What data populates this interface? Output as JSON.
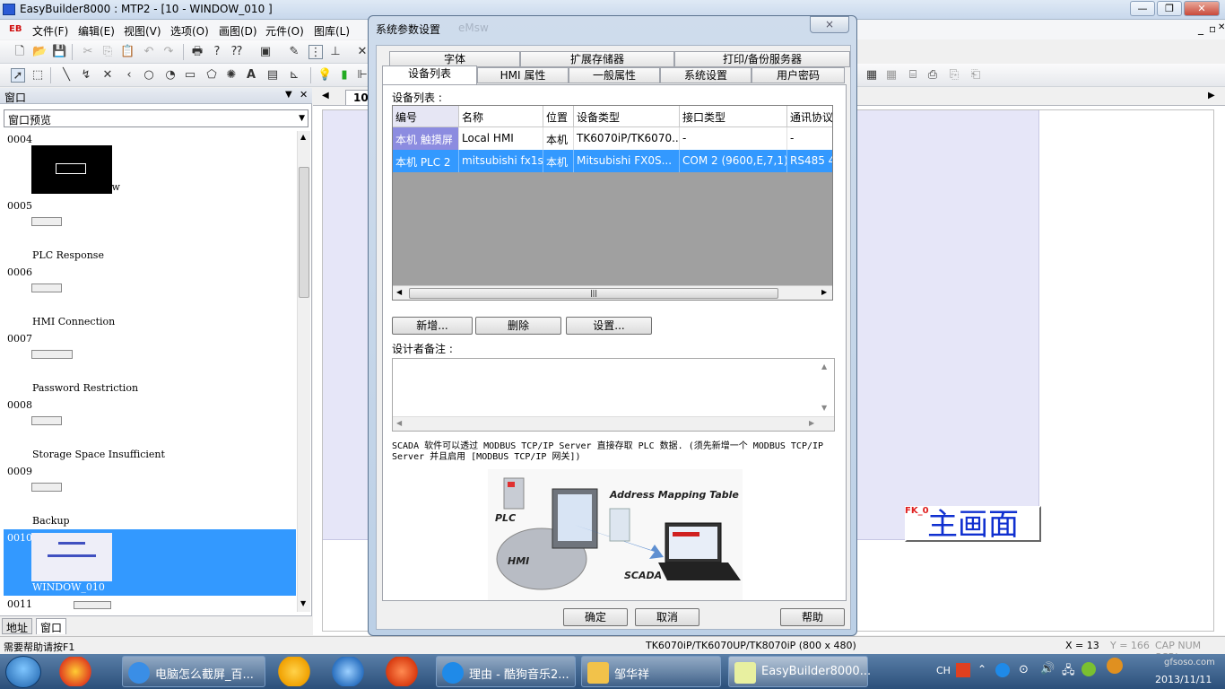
{
  "app": {
    "title": "EasyBuilder8000 : MTP2 - [10 - WINDOW_010 ]",
    "menu": [
      "文件(F)",
      "编辑(E)",
      "视图(V)",
      "选项(O)",
      "画图(D)",
      "元件(O)",
      "图库(L)"
    ],
    "menu_badge": "EB"
  },
  "left_panel": {
    "header": "窗口",
    "select_value": "窗口预览",
    "windows": [
      {
        "num": "0004",
        "name": "Common Window"
      },
      {
        "num": "0005",
        "name": "PLC Response"
      },
      {
        "num": "0006",
        "name": "HMI Connection"
      },
      {
        "num": "0007",
        "name": "Password Restriction"
      },
      {
        "num": "0008",
        "name": "Storage Space Insufficient"
      },
      {
        "num": "0009",
        "name": "Backup"
      },
      {
        "num": "0010",
        "name": "WINDOW_010"
      },
      {
        "num": "0011",
        "name": ""
      }
    ],
    "tabs": [
      "地址",
      "窗口"
    ]
  },
  "canvas": {
    "tab_label": "10",
    "fk_label": "FK_0",
    "main_button": "主画面"
  },
  "dialog": {
    "title": "系统参数设置",
    "ghost_title": "eMsw",
    "close_label": "×",
    "tabs_row1": [
      "字体",
      "扩展存储器",
      "打印/备份服务器"
    ],
    "tabs_row2": [
      "设备列表",
      "HMI 属性",
      "一般属性",
      "系统设置",
      "用户密码"
    ],
    "device_list_label": "设备列表 :",
    "columns": [
      "编号",
      "名称",
      "位置",
      "设备类型",
      "接口类型",
      "通讯协议"
    ],
    "rows": [
      [
        "本机 触摸屏",
        "Local HMI",
        "本机",
        "TK6070iP/TK6070...",
        "-",
        "-"
      ],
      [
        "本机 PLC 2",
        "mitsubishi fx1s",
        "本机",
        "Mitsubishi FX0S...",
        "COM 2 (9600,E,7,1)",
        "RS485 4"
      ]
    ],
    "buttons": {
      "add": "新增...",
      "delete": "删除",
      "settings": "设置..."
    },
    "notes_label": "设计者备注 :",
    "scada_text": "SCADA 软件可以透过 MODBUS TCP/IP Server 直接存取 PLC 数据. (须先新增一个 MODBUS TCP/IP Server 并且启用 [MODBUS TCP/IP 网关])",
    "image_labels": {
      "amt": "Address Mapping Table",
      "plc": "PLC",
      "hmi": "HMI",
      "scada": "SCADA"
    },
    "footer": {
      "ok": "确定",
      "cancel": "取消",
      "help": "帮助"
    }
  },
  "statusbar": {
    "help": "需要帮助请按F1",
    "model": "TK6070iP/TK6070UP/TK8070iP (800 x 480)",
    "x": "X = 13",
    "y": "Y = 166",
    "caps": "CAP NUM SCRL"
  },
  "taskbar": {
    "tasks": [
      "电脑怎么截屏_百...",
      "理由 - 酷狗音乐2...",
      "邹华祥",
      "EasyBuilder8000..."
    ],
    "tray_lang": "CH",
    "date": "2013/11/11",
    "watermark": "gfsoso.com"
  },
  "colors": {
    "selection": "#3399ff",
    "canvas_bg": "#e6e6f8",
    "main_button_text": "#1030d0",
    "fk_label": "#e02020"
  }
}
